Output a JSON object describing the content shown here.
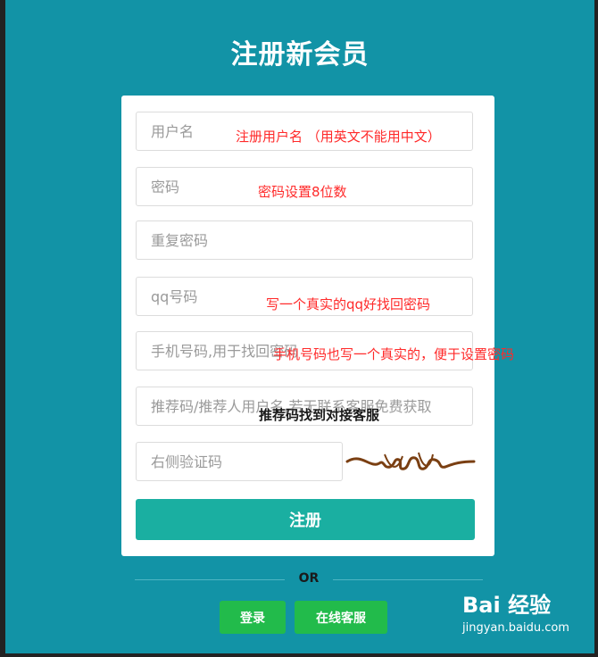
{
  "page": {
    "title": "注册新会员"
  },
  "form": {
    "username_placeholder": "用户名",
    "password_placeholder": "密码",
    "repeat_password_placeholder": "重复密码",
    "qq_placeholder": "qq号码",
    "phone_placeholder": "手机号码,用于找回密码",
    "referral_placeholder": "推荐码/推荐人用户名,若无联系客服免费获取",
    "captcha_placeholder": "右侧验证码",
    "submit_label": "注册"
  },
  "annotations": {
    "username_note": "注册用户名 （用英文不能用中文）",
    "password_note": "密码设置8位数",
    "qq_note": "写一个真实的qq好找回密码",
    "phone_note": "手机号码也写一个真实的，便于设置密码",
    "referral_note": "推荐码找到对接客服"
  },
  "footer": {
    "or_label": "OR",
    "login_label": "登录",
    "service_label": "在线客服"
  },
  "watermark": {
    "logo": "Bai 经验",
    "url": "jingyan.baidu.com"
  },
  "colors": {
    "background": "#1293a6",
    "primary": "#1aafa1",
    "green": "#22bb4b",
    "note_red": "#ff2a2a"
  }
}
